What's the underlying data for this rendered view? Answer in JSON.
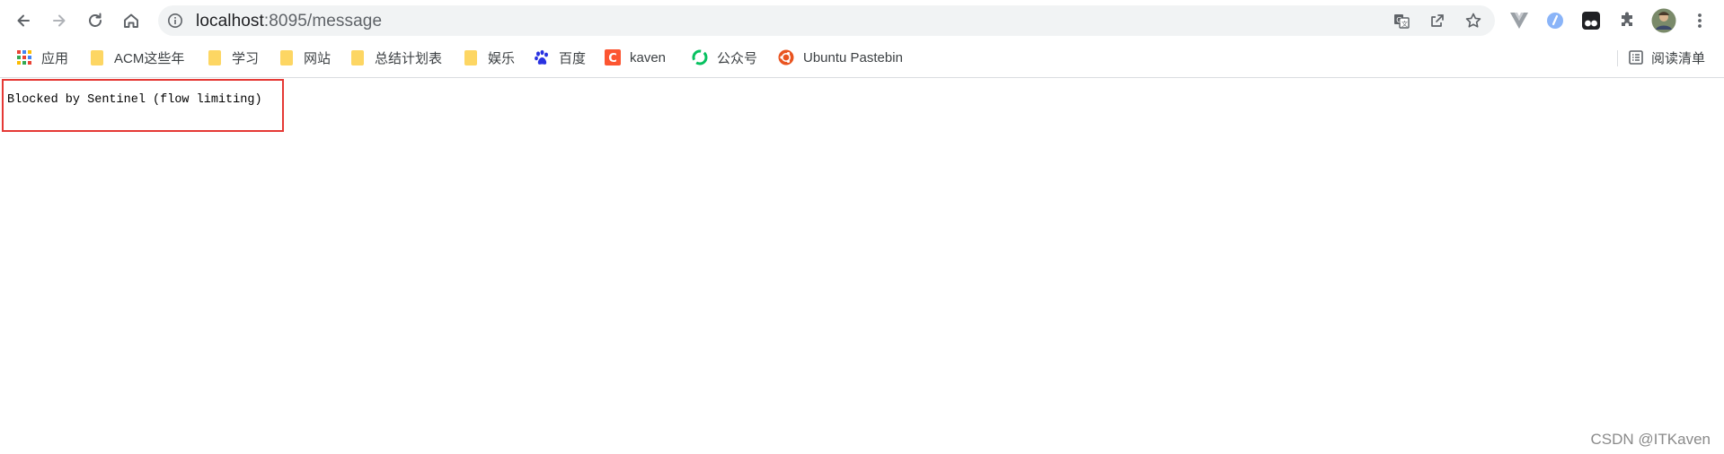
{
  "browser": {
    "url_host": "localhost",
    "url_rest": ":8095/message",
    "icons": {
      "back": "back-arrow-icon",
      "forward": "forward-arrow-icon",
      "reload": "reload-icon",
      "home": "home-icon",
      "site_info": "info-icon",
      "translate": "translate-icon",
      "share": "share-icon",
      "bookmark_star": "star-icon",
      "extensions": "puzzle-icon",
      "menu": "kebab-menu-icon"
    }
  },
  "bookmarks": [
    {
      "label": "应用",
      "icon": "apps-grid-icon"
    },
    {
      "label": "ACM这些年",
      "icon": "folder-icon"
    },
    {
      "label": "学习",
      "icon": "folder-icon"
    },
    {
      "label": "网站",
      "icon": "folder-icon"
    },
    {
      "label": "总结计划表",
      "icon": "folder-icon"
    },
    {
      "label": "娱乐",
      "icon": "folder-icon"
    },
    {
      "label": "百度",
      "icon": "baidu-paw-icon"
    },
    {
      "label": "kaven",
      "icon": "csdn-c-icon"
    },
    {
      "label": "公众号",
      "icon": "wechat-green-icon"
    },
    {
      "label": "Ubuntu Pastebin",
      "icon": "ubuntu-icon"
    }
  ],
  "reading_list": {
    "label": "阅读清单",
    "icon": "reading-list-icon"
  },
  "page": {
    "message": "Blocked by Sentinel (flow limiting)"
  },
  "watermark": "CSDN @ITKaven",
  "colors": {
    "highlight_border": "#e53935",
    "folder": "#fdd663",
    "omnibox_bg": "#f1f3f4"
  }
}
